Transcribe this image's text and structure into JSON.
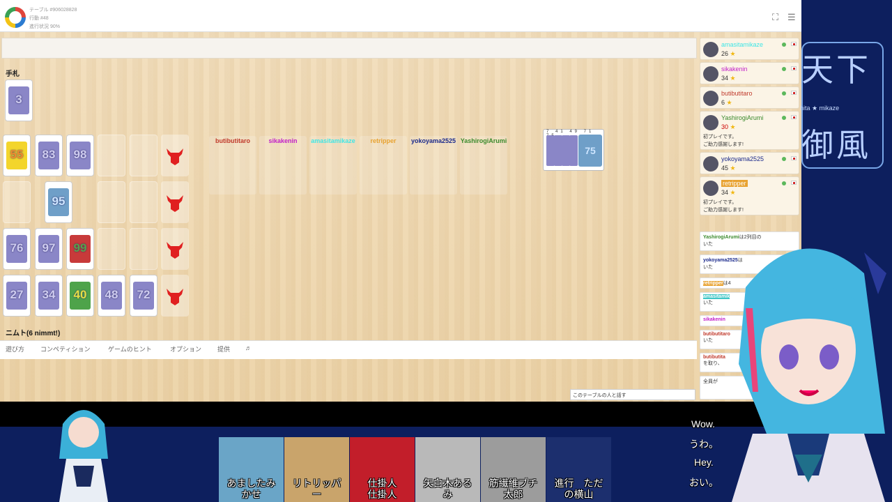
{
  "header": {
    "table": "テーブル #906028828",
    "move": "行動 #48",
    "progress": "進行状況 90%"
  },
  "hand": {
    "title": "手札",
    "card": "3"
  },
  "rows": [
    [
      "55",
      "83",
      "98"
    ],
    [
      "",
      "95"
    ],
    [
      "76",
      "97",
      "99"
    ],
    [
      "27",
      "34",
      "40",
      "48",
      "72"
    ]
  ],
  "player_columns": [
    {
      "name": "butibutitaro",
      "color": "#c0392b"
    },
    {
      "name": "sikakenin",
      "color": "#c21ec9"
    },
    {
      "name": "amasitamikaze",
      "color": "#3fe6e6"
    },
    {
      "name": "retripper",
      "color": "#e8a230"
    },
    {
      "name": "yokoyama2525",
      "color": "#1b2a8c"
    },
    {
      "name": "YashirogiArumi",
      "color": "#3a8a2c"
    }
  ],
  "stack": {
    "digits": "7 41 49 71 75",
    "card": "75"
  },
  "players": [
    {
      "name": "amasitamikaze",
      "score": "26",
      "color": "#3fe6e6",
      "msg": ""
    },
    {
      "name": "sikakenin",
      "score": "34",
      "color": "#c21ec9",
      "msg": ""
    },
    {
      "name": "butibutitaro",
      "score": "6",
      "color": "#c0392b",
      "msg": ""
    },
    {
      "name": "YashirogiArumi",
      "score": "30",
      "color": "#3a8a2c",
      "msg": "初プレイです。\nご助力感謝します!"
    },
    {
      "name": "yokoyama2525",
      "score": "45",
      "color": "#1b2a8c",
      "msg": ""
    },
    {
      "name": "retripper",
      "score": "34",
      "color": "#e8a230",
      "msg": "初プレイです。\nご助力感謝します!"
    }
  ],
  "log": [
    {
      "name": "YashirogiArumi",
      "text": "は2列目の",
      "tail": "いた"
    },
    {
      "name": "yokoyama2525",
      "text": "は",
      "tail": "いた"
    },
    {
      "name": "retripper",
      "text": "は4",
      "tail": ""
    },
    {
      "name": "amasitamik",
      "text": "",
      "tail": "いた"
    },
    {
      "name": "sikakenin",
      "text": "",
      "tail": ""
    },
    {
      "name": "butibutitaro",
      "text": "",
      "tail": "いた"
    },
    {
      "name": "butibutita",
      "text": "",
      "tail": "を取り、"
    },
    {
      "name": "",
      "text": "全員が",
      "tail": ""
    }
  ],
  "game_name": "ニムト(6 nimmt!)",
  "nav": [
    "遊び方",
    "コンペティション",
    "ゲームのヒント",
    "オプション",
    "提供"
  ],
  "chat_placeholder": "このテーブルの人と話す",
  "stream": {
    "tenka_sub": "hita ★ mikaze",
    "guests": [
      {
        "label": "あましたみ\nかせ"
      },
      {
        "label": "リトリッパ\nー"
      },
      {
        "label": "仕掛人\n仕掛人"
      },
      {
        "label": "矢白木ある\nみ"
      },
      {
        "label": "筋繊維ブチ\n太郎"
      },
      {
        "label": "進行　ただ\nの横山"
      }
    ],
    "subs": [
      "Wow.",
      "うわ。",
      "Hey.",
      "おい。"
    ]
  }
}
